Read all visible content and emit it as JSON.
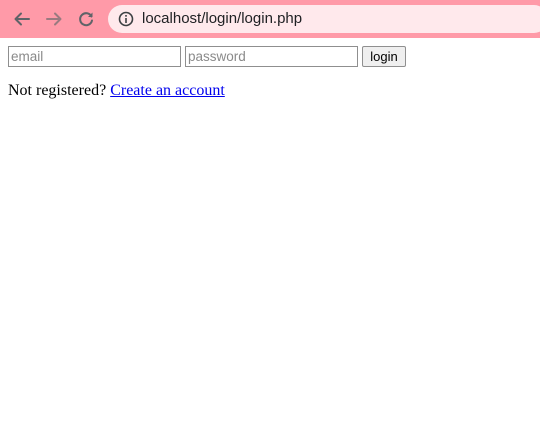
{
  "browser": {
    "url": "localhost/login/login.php",
    "toolbar_color": "#ff9aa8",
    "omnibox_color": "#ffe9ec",
    "icons": {
      "back": "arrow-left-icon",
      "forward": "arrow-right-icon",
      "reload": "reload-icon",
      "info": "info-icon"
    }
  },
  "form": {
    "email_placeholder": "email",
    "email_value": "",
    "password_placeholder": "password",
    "password_value": "",
    "login_label": "login"
  },
  "register": {
    "prompt": "Not registered?",
    "link_text": "Create an account",
    "link_color": "#0000ee"
  }
}
